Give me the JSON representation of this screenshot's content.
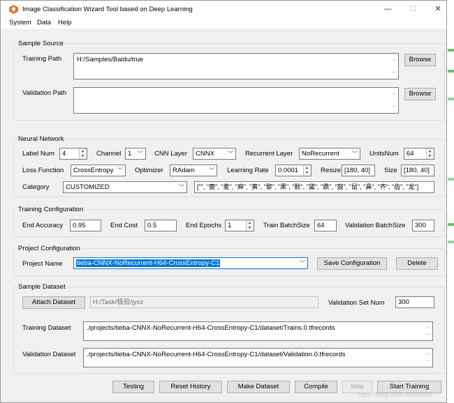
{
  "window": {
    "title": "Image Classification Wizard Tool based on Deep Learning"
  },
  "menu": [
    "System",
    "Data",
    "Help"
  ],
  "sample_source": {
    "title": "Sample Source",
    "training_path_label": "Training Path",
    "training_path_value": "H:/Samples/Baidu/true",
    "validation_path_label": "Validation Path",
    "validation_path_value": "",
    "browse_label": "Browse"
  },
  "neural_network": {
    "title": "Neural Network",
    "label_num_label": "Label Num",
    "label_num_value": "4",
    "channel_label": "Channel",
    "channel_value": "1",
    "cnn_layer_label": "CNN Layer",
    "cnn_layer_value": "CNNX",
    "recurrent_layer_label": "Recurrent Layer",
    "recurrent_layer_value": "NoRecurrent",
    "units_num_label": "UnitsNum",
    "units_num_value": "64",
    "loss_function_label": "Loss Function",
    "loss_function_value": "CrossEntropy",
    "optimizer_label": "Optimizer",
    "optimizer_value": "RAdam",
    "learning_rate_label": "Learning Rate",
    "learning_rate_value": "0.0001",
    "resize_label": "Resize",
    "resize_value": "[180, 40]",
    "size_label": "Size",
    "size_value": "[180, 40]",
    "category_label": "Category",
    "category_value": "CUSTOMIZED",
    "category_chars": "[\"\", \"鹿\", \"麦\", \"麻\", \"黄\", \"黎\", \"黑\", \"默\", \"黛\", \"鼎\", \"鼓\", \"鼠\", \"鼻\", \"齐\", \"齿\", \"龙\"]"
  },
  "training_config": {
    "title": "Training Configuration",
    "end_accuracy_label": "End Accuracy",
    "end_accuracy_value": "0.95",
    "end_cost_label": "End Cost",
    "end_cost_value": "0.5",
    "end_epochs_label": "End Epochs",
    "end_epochs_value": "1",
    "train_batch_label": "Train BatchSize",
    "train_batch_value": "64",
    "validation_batch_label": "Validation BatchSize",
    "validation_batch_value": "300"
  },
  "project_config": {
    "title": "Project Configuration",
    "project_name_label": "Project Name",
    "project_name_value": "tieba-CNNX-NoRecurrent-H64-CrossEntropy-C1",
    "save_label": "Save Configuration",
    "delete_label": "Delete"
  },
  "sample_dataset": {
    "title": "Sample Dataset",
    "attach_label": "Attach Dataset",
    "attach_path": "H:/Task/极验/jyxz",
    "validation_set_num_label": "Validation Set Num",
    "validation_set_num_value": "300",
    "training_dataset_label": "Training Dataset",
    "training_dataset_value": "./projects/tieba-CNNX-NoRecurrent-H64-CrossEntropy-C1/dataset/Trains.0.tfrecords",
    "validation_dataset_label": "Validation Dataset",
    "validation_dataset_value": "./projects/tieba-CNNX-NoRecurrent-H64-CrossEntropy-C1/dataset/Validation.0.tfrecords"
  },
  "actions": {
    "testing": "Testing",
    "reset_history": "Reset History",
    "make_dataset": "Make Dataset",
    "compile": "Compile",
    "stop": "Stop",
    "start_training": "Start Training"
  },
  "watermark": "https://blog.csdn.net/kerlon",
  "colors": {
    "accent": "#0078d7",
    "window_bg": "#f0f0f0",
    "app_icon": "#e8742a"
  },
  "icons": {
    "minimize": "—",
    "maximize": "☐",
    "close": "✕"
  }
}
